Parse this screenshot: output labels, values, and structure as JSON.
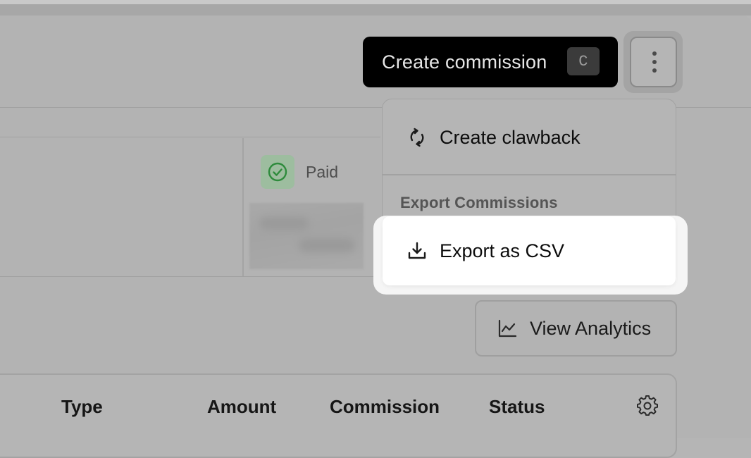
{
  "toolbar": {
    "create_label": "Create commission",
    "create_shortcut": "C",
    "more_icon": "more-vertical-icon"
  },
  "card": {
    "status_label": "Paid",
    "status_icon": "check-circle-icon"
  },
  "menu": {
    "items": [
      {
        "label": "Create clawback",
        "icon": "refresh-icon"
      }
    ],
    "section_title": "Export Commissions",
    "export_items": [
      {
        "label": "Export as CSV",
        "icon": "download-icon"
      }
    ]
  },
  "analytics": {
    "label": "View Analytics",
    "icon": "line-chart-icon"
  },
  "table": {
    "columns": [
      "Type",
      "Amount",
      "Commission",
      "Status"
    ],
    "settings_icon": "gear-icon"
  },
  "colors": {
    "overlay_gray": "#b5b5b5",
    "primary_button": "#000000",
    "highlight": "#ffffff",
    "paid_green": "#2e8b3c"
  }
}
